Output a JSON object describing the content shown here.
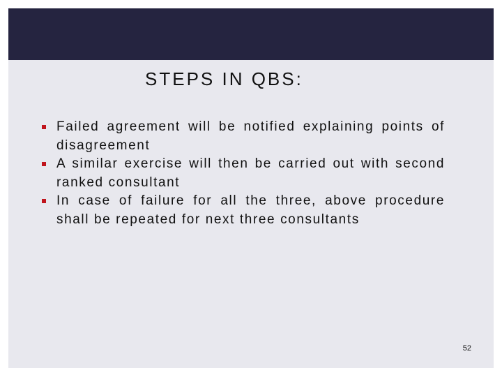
{
  "slide": {
    "title": "STEPS IN QBS:",
    "bullets": [
      {
        "text": "Failed agreement will be notified explaining points of disagreement"
      },
      {
        "text": "A similar exercise will then be carried out with second ranked consultant"
      },
      {
        "text": "In case of failure for all the three, above procedure shall be repeated for next three consultants"
      }
    ],
    "page_number": "52",
    "colors": {
      "header_band": "#252440",
      "background": "#e8e8ee",
      "bullet": "#c0141c",
      "text": "#111111"
    }
  }
}
